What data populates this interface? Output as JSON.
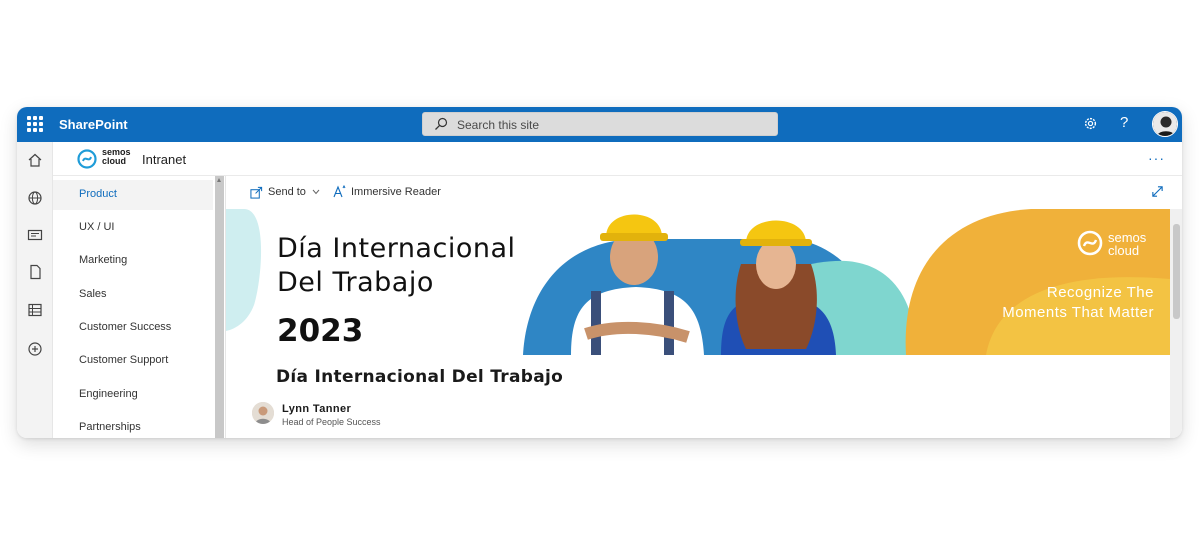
{
  "topbar": {
    "app_name": "SharePoint",
    "search_placeholder": "Search this site",
    "help_label": "?"
  },
  "left_rail": {
    "icons": [
      "home-icon",
      "globe-icon",
      "news-icon",
      "document-icon",
      "list-icon",
      "add-icon"
    ]
  },
  "site": {
    "logo_text_line1": "semos",
    "logo_text_line2": "cloud",
    "title": "Intranet",
    "more_label": "···"
  },
  "nav": {
    "items": [
      {
        "label": "Product",
        "active": true
      },
      {
        "label": "UX / UI"
      },
      {
        "label": "Marketing"
      },
      {
        "label": "Sales"
      },
      {
        "label": "Customer Success"
      },
      {
        "label": "Customer Support"
      },
      {
        "label": "Engineering"
      },
      {
        "label": "Partnerships"
      }
    ]
  },
  "commands": {
    "send_to": "Send to",
    "immersive_reader": "Immersive Reader"
  },
  "banner": {
    "title_line1": "Día Internacional",
    "title_line2": "Del Trabajo",
    "year": "2023",
    "logo_line1": "semos",
    "logo_line2": "cloud",
    "tagline_line1": "Recognize The",
    "tagline_line2": "Moments That Matter",
    "colors": {
      "blue": "#2f86c5",
      "teal": "#7fd6cf",
      "amber": "#f0b13a",
      "yellow": "#f5d24b"
    }
  },
  "page": {
    "title": "Día Internacional Del Trabajo",
    "author_name": "Lynn Tanner",
    "author_role": "Head of People Success"
  }
}
